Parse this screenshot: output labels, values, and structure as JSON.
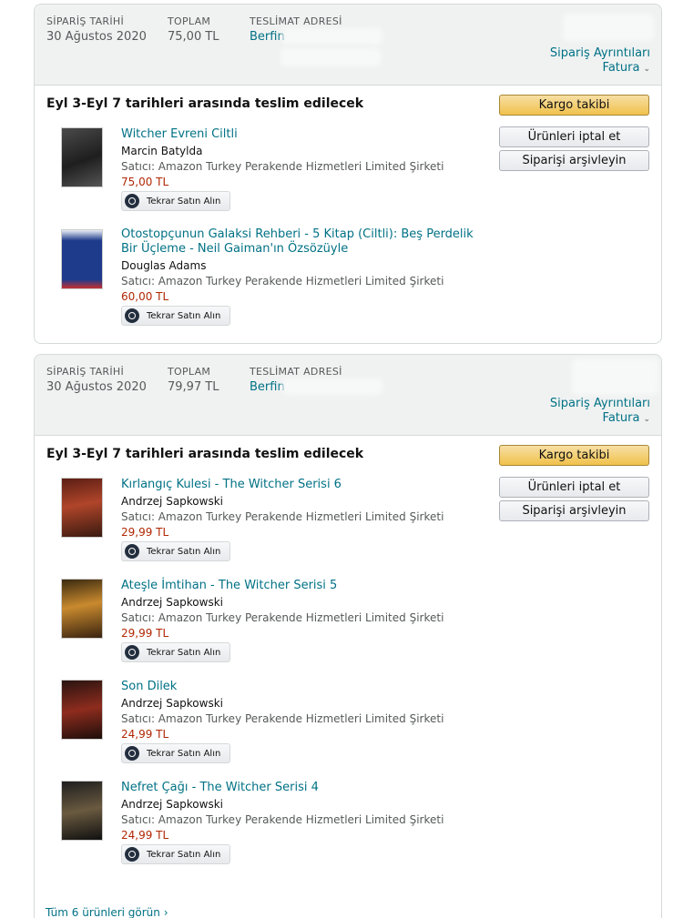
{
  "labels": {
    "order_date": "SİPARİŞ TARİHİ",
    "total": "TOPLAM",
    "shipping_address": "TESLİMAT ADRESİ",
    "order_details": "Sipariş Ayrıntıları",
    "invoice": "Fatura",
    "track": "Kargo takibi",
    "cancel": "Ürünleri iptal et",
    "archive": "Siparişi arşivleyin",
    "rebuy": "Tekrar Satın Alın"
  },
  "orders": [
    {
      "date": "30 Ağustos 2020",
      "total": "75,00 TL",
      "recipient": "Berfin",
      "delivery": "Eyl 3-Eyl 7 tarihleri arasında teslim edilecek",
      "items": [
        {
          "title": "Witcher Evreni Ciltli",
          "author": "Marcin Batylda",
          "seller": "Satıcı: Amazon Turkey Perakende Hizmetleri Limited Şirketi",
          "price": "75,00 TL"
        },
        {
          "title": "Otostopçunun Galaksi Rehberi - 5 Kitap (Ciltli): Beş Perdelik Bir Üçleme - Neil Gaiman'ın Özsözüyle",
          "author": "Douglas Adams",
          "seller": "Satıcı: Amazon Turkey Perakende Hizmetleri Limited Şirketi",
          "price": "60,00 TL"
        }
      ]
    },
    {
      "date": "30 Ağustos 2020",
      "total": "79,97 TL",
      "recipient": "Berfin",
      "delivery": "Eyl 3-Eyl 7 tarihleri arasında teslim edilecek",
      "items": [
        {
          "title": "Kırlangıç Kulesi - The Witcher Serisi 6",
          "author": "Andrzej Sapkowski",
          "seller": "Satıcı: Amazon Turkey Perakende Hizmetleri Limited Şirketi",
          "price": "29,99 TL"
        },
        {
          "title": "Ateşle İmtihan - The Witcher Serisi 5",
          "author": "Andrzej Sapkowski",
          "seller": "Satıcı: Amazon Turkey Perakende Hizmetleri Limited Şirketi",
          "price": "29,99 TL"
        },
        {
          "title": "Son Dilek",
          "author": "Andrzej Sapkowski",
          "seller": "Satıcı: Amazon Turkey Perakende Hizmetleri Limited Şirketi",
          "price": "24,99 TL"
        },
        {
          "title": "Nefret Çağı - The Witcher Serisi 4",
          "author": "Andrzej Sapkowski",
          "seller": "Satıcı: Amazon Turkey Perakende Hizmetleri Limited Şirketi",
          "price": "24,99 TL"
        }
      ]
    }
  ],
  "see_all": "Tüm 6 ürünleri görün ›"
}
